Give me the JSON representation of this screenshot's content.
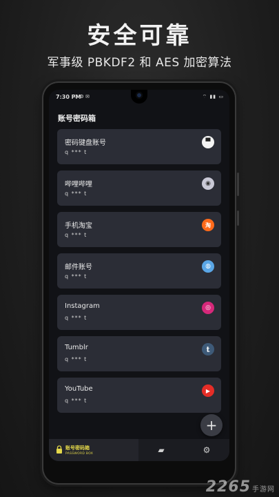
{
  "promo": {
    "title": "安全可靠",
    "subtitle": "军事级 PBKDF2 和 AES 加密算法"
  },
  "status_bar": {
    "time": "7:30 PM",
    "left_icons": "⚇ ⚙ ✉",
    "right_icons": "⌔ ▮▮ ▭"
  },
  "app": {
    "title": "账号密码箱"
  },
  "accounts": [
    {
      "name": "密码键盘账号",
      "user": "q *** t",
      "icon": "keyboard-app-icon",
      "icon_color": "#f4f4f4"
    },
    {
      "name": "哔哩哔哩",
      "user": "q *** t",
      "icon": "bilibili-icon",
      "icon_color": "#c9c9d6"
    },
    {
      "name": "手机淘宝",
      "user": "q *** t",
      "icon": "taobao-icon",
      "icon_color": "#ff6a1a"
    },
    {
      "name": "邮件账号",
      "user": "q *** t",
      "icon": "mail-globe-icon",
      "icon_color": "#5aa6e6"
    },
    {
      "name": "Instagram",
      "user": "q *** t",
      "icon": "instagram-icon",
      "icon_color": "#d6287a"
    },
    {
      "name": "Tumblr",
      "user": "q *** t",
      "icon": "tumblr-icon",
      "icon_color": "#3e5a78"
    },
    {
      "name": "YouTube",
      "user": "q *** t",
      "icon": "youtube-icon",
      "icon_color": "#e52d27"
    }
  ],
  "icon_glyphs": [
    "▀",
    "◉",
    "淘",
    "◍",
    "◎",
    "t",
    "▶"
  ],
  "fab": {
    "label": "+"
  },
  "bottom_nav": {
    "home_label": "账号密码箱",
    "home_sub": "PASSWORD BOX",
    "notes_glyph": "▰",
    "settings_glyph": "⚙"
  },
  "watermark": {
    "text": "2265",
    "sub": "手游网"
  }
}
